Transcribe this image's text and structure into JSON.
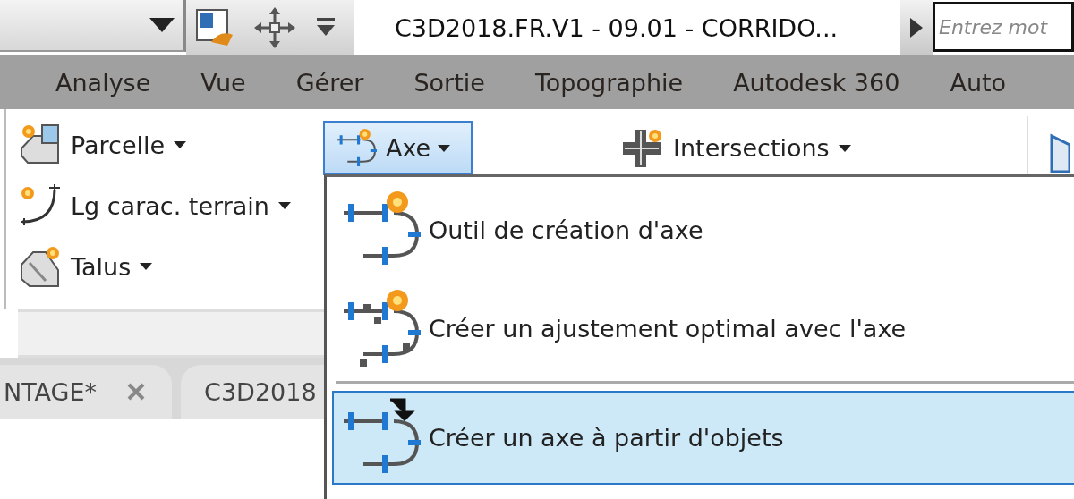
{
  "title": "C3D2018.FR.V1 - 09.01 - CORRIDO...",
  "search": {
    "placeholder": "Entrez mot"
  },
  "ribbon_tabs": [
    {
      "label": "Analyse",
      "selected": false
    },
    {
      "label": "Vue",
      "selected": false
    },
    {
      "label": "Gérer",
      "selected": false
    },
    {
      "label": "Sortie",
      "selected": false
    },
    {
      "label": "Topographie",
      "selected": false
    },
    {
      "label": "Autodesk 360",
      "selected": false
    },
    {
      "label": "Auto",
      "selected": false
    }
  ],
  "panel_tools": [
    {
      "label": "Parcelle",
      "kind": "parcel"
    },
    {
      "label": "Lg carac. terrain",
      "kind": "feature-line"
    },
    {
      "label": "Talus",
      "kind": "grading"
    }
  ],
  "axis_button": {
    "label": "Axe",
    "expanded": true
  },
  "intersections_button": {
    "label": "Intersections"
  },
  "menu_items": [
    {
      "label": "Outil de création d'axe",
      "kind": "create",
      "selected": false
    },
    {
      "label": "Créer un ajustement optimal avec l'axe",
      "kind": "best-fit",
      "selected": false
    },
    {
      "label": "Créer un axe à partir d'objets",
      "kind": "from-objects",
      "selected": true
    }
  ],
  "document_tabs": [
    {
      "label": "NTAGE*",
      "closable": true
    },
    {
      "label": "C3D2018",
      "closable": false
    }
  ]
}
